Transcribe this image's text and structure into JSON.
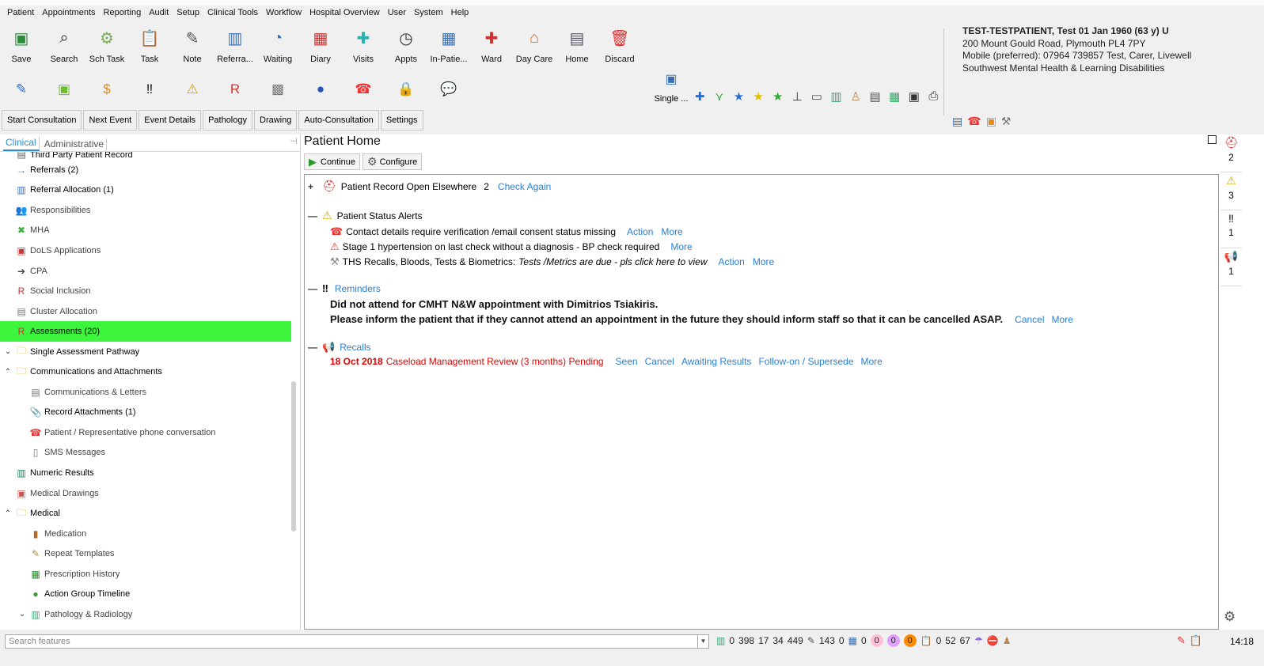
{
  "menu": [
    "Patient",
    "Appointments",
    "Reporting",
    "Audit",
    "Setup",
    "Clinical Tools",
    "Workflow",
    "Hospital Overview",
    "User",
    "System",
    "Help"
  ],
  "toolbar_main": [
    {
      "label": "Save",
      "icon": "save-icon",
      "glyph": "▣",
      "color": "#2e8b3d"
    },
    {
      "label": "Search",
      "icon": "search-icon",
      "glyph": "⌕",
      "color": "#333"
    },
    {
      "label": "Sch Task",
      "icon": "scheduled-task-icon",
      "glyph": "⚙",
      "color": "#7a5"
    },
    {
      "label": "Task",
      "icon": "task-icon",
      "glyph": "📋",
      "color": "#b8860b"
    },
    {
      "label": "Note",
      "icon": "note-icon",
      "glyph": "✎",
      "color": "#555"
    },
    {
      "label": "Referra...",
      "icon": "referral-icon",
      "glyph": "▥",
      "color": "#3a6fb5"
    },
    {
      "label": "Waiting",
      "icon": "waiting-icon",
      "glyph": "◔",
      "color": "#3a6fb5"
    },
    {
      "label": "Diary",
      "icon": "diary-icon",
      "glyph": "▦",
      "color": "#c33"
    },
    {
      "label": "Visits",
      "icon": "visits-icon",
      "glyph": "✚",
      "color": "#2ab0b0"
    },
    {
      "label": "Appts",
      "icon": "appointments-icon",
      "glyph": "◷",
      "color": "#333"
    },
    {
      "label": "In-Patie...",
      "icon": "in-patient-icon",
      "glyph": "▦",
      "color": "#3a6fb5"
    },
    {
      "label": "Ward",
      "icon": "ward-icon",
      "glyph": "✚",
      "color": "#c33"
    },
    {
      "label": "Day Care",
      "icon": "day-care-icon",
      "glyph": "⌂",
      "color": "#d2691e"
    },
    {
      "label": "Home",
      "icon": "home-icon",
      "glyph": "▤",
      "color": "#556"
    },
    {
      "label": "Discard",
      "icon": "discard-icon",
      "glyph": "🗑",
      "color": "#d33"
    }
  ],
  "toolbar_row2": [
    {
      "icon": "edit-user-icon",
      "glyph": "✎",
      "color": "#2a6fd0"
    },
    {
      "icon": "assessment-icon",
      "glyph": "▣",
      "color": "#6bbf2a"
    },
    {
      "icon": "document-icon",
      "glyph": "$",
      "color": "#e08a1a"
    },
    {
      "icon": "reminders-icon",
      "glyph": "‼",
      "color": "#111"
    },
    {
      "icon": "warning-person-icon",
      "glyph": "⚠",
      "color": "#d8a000"
    },
    {
      "icon": "form-r-icon",
      "glyph": "R",
      "color": "#c33"
    },
    {
      "icon": "grid-icon",
      "glyph": "▩",
      "color": "#777"
    },
    {
      "icon": "blue-circle-icon",
      "glyph": "●",
      "color": "#2a55b5"
    },
    {
      "icon": "phone-icon",
      "glyph": "☎",
      "color": "#e33"
    },
    {
      "icon": "lock-icon",
      "glyph": "🔒",
      "color": "#555"
    },
    {
      "icon": "chat-icon",
      "glyph": "💬",
      "color": "#8a6fd0"
    }
  ],
  "single_button": {
    "label": "Single ..."
  },
  "small_icons": [
    {
      "icon": "medical-bag-icon",
      "glyph": "✚",
      "color": "#2a6fd0"
    },
    {
      "icon": "filter-icon",
      "glyph": "⋎",
      "color": "#4a4"
    },
    {
      "icon": "blue-star-icon",
      "glyph": "★",
      "color": "#2a6fd0"
    },
    {
      "icon": "yellow-star-icon",
      "glyph": "★",
      "color": "#e0c000"
    },
    {
      "icon": "green-star-icon",
      "glyph": "★",
      "color": "#3a3"
    },
    {
      "icon": "split-icon",
      "glyph": "⊥",
      "color": "#333"
    },
    {
      "icon": "window-icon",
      "glyph": "▭",
      "color": "#555"
    },
    {
      "icon": "bar-chart-icon",
      "glyph": "▥",
      "color": "#3a7"
    },
    {
      "icon": "doctor-icon",
      "glyph": "♙",
      "color": "#b85"
    },
    {
      "icon": "notes-icon",
      "glyph": "▤",
      "color": "#555"
    },
    {
      "icon": "folder-icon",
      "glyph": "▦",
      "color": "#3a6"
    },
    {
      "icon": "print-preview-icon",
      "glyph": "▣",
      "color": "#333"
    },
    {
      "icon": "print-icon",
      "glyph": "⎙",
      "color": "#333"
    }
  ],
  "patient": {
    "name": "TEST-TESTPATIENT, Test 01 Jan 1960 (63 y) U",
    "address": "200 Mount Gould Road, Plymouth PL4 7PY",
    "mobile": "Mobile (preferred): 07964 739857   Test, Carer, Livewell",
    "team": "Southwest Mental Health & Learning Disabilities"
  },
  "consult_buttons": [
    "Start Consultation",
    "Next Event",
    "Event Details",
    "Pathology",
    "Drawing",
    "Auto-Consultation",
    "Settings"
  ],
  "left_tabs": [
    "Clinical",
    "Administrative"
  ],
  "tree": [
    {
      "label": "Third Party Patient Record",
      "icon": "record-icon",
      "glyph": "▤",
      "color": "#555",
      "indent": 0,
      "arrow": "",
      "partial": true
    },
    {
      "label": "Referrals (2)",
      "icon": "arrow-right-icon",
      "glyph": "→",
      "color": "#2a6fd0",
      "indent": 0,
      "arrow": ""
    },
    {
      "label": "Referral Allocation (1)",
      "icon": "referral-allocation-icon",
      "glyph": "▥",
      "color": "#3a6fb5",
      "indent": 0,
      "arrow": ""
    },
    {
      "label": "Responsibilities",
      "icon": "people-icon",
      "glyph": "👥",
      "color": "#e08a40",
      "indent": 0,
      "arrow": "",
      "grey": true
    },
    {
      "label": "MHA",
      "icon": "mha-icon",
      "glyph": "✖",
      "color": "#3ab03a",
      "indent": 0,
      "arrow": "",
      "grey": true
    },
    {
      "label": "DoLS Applications",
      "icon": "dols-icon",
      "glyph": "▣",
      "color": "#c33",
      "indent": 0,
      "arrow": "",
      "grey": true
    },
    {
      "label": "CPA",
      "icon": "cpa-arrow-icon",
      "glyph": "➔",
      "color": "#444",
      "indent": 0,
      "arrow": "",
      "grey": true
    },
    {
      "label": "Social Inclusion",
      "icon": "social-inclusion-icon",
      "glyph": "R",
      "color": "#c33",
      "indent": 0,
      "arrow": "",
      "grey": true
    },
    {
      "label": "Cluster Allocation",
      "icon": "cluster-icon",
      "glyph": "▤",
      "color": "#777",
      "indent": 0,
      "arrow": "",
      "grey": true
    },
    {
      "label": "Assessments (20)",
      "icon": "assessments-icon",
      "glyph": "R",
      "color": "#c33",
      "indent": 0,
      "arrow": "",
      "selected": true
    },
    {
      "label": "Single Assessment Pathway",
      "icon": "folder-icon",
      "glyph": "🗀",
      "color": "#d8b000",
      "indent": 0,
      "arrow": "⌄"
    },
    {
      "label": "Communications and Attachments",
      "icon": "folder-open-icon",
      "glyph": "🗀",
      "color": "#d8b000",
      "indent": 0,
      "arrow": "⌃"
    },
    {
      "label": "Communications & Letters",
      "icon": "letters-icon",
      "glyph": "▤",
      "color": "#777",
      "indent": 1,
      "arrow": "",
      "grey": true
    },
    {
      "label": "Record Attachments (1)",
      "icon": "paperclip-icon",
      "glyph": "📎",
      "color": "#555",
      "indent": 1,
      "arrow": ""
    },
    {
      "label": "Patient / Representative phone conversation",
      "icon": "phone-icon",
      "glyph": "☎",
      "color": "#e33",
      "indent": 1,
      "arrow": "",
      "grey": true
    },
    {
      "label": "SMS Messages",
      "icon": "sms-icon",
      "glyph": "▯",
      "color": "#777",
      "indent": 1,
      "arrow": "",
      "grey": true
    },
    {
      "label": "Numeric Results",
      "icon": "chart-icon",
      "glyph": "▥",
      "color": "#2a7f5a",
      "indent": 0,
      "arrow": ""
    },
    {
      "label": "Medical Drawings",
      "icon": "drawing-icon",
      "glyph": "▣",
      "color": "#c55",
      "indent": 0,
      "arrow": "",
      "grey": true
    },
    {
      "label": "Medical",
      "icon": "folder-open-icon",
      "glyph": "🗀",
      "color": "#d8b000",
      "indent": 0,
      "arrow": "⌃"
    },
    {
      "label": "Medication",
      "icon": "medication-icon",
      "glyph": "▮",
      "color": "#b06a2a",
      "indent": 1,
      "arrow": "",
      "grey": true
    },
    {
      "label": "Repeat Templates",
      "icon": "repeat-templates-icon",
      "glyph": "✎",
      "color": "#b08a40",
      "indent": 1,
      "arrow": "",
      "grey": true
    },
    {
      "label": "Prescription History",
      "icon": "prescription-icon",
      "glyph": "▦",
      "color": "#2a8a2a",
      "indent": 1,
      "arrow": "",
      "grey": true
    },
    {
      "label": "Action Group Timeline",
      "icon": "timeline-icon",
      "glyph": "●",
      "color": "#3a9a3a",
      "indent": 1,
      "arrow": ""
    },
    {
      "label": "Pathology & Radiology",
      "icon": "pathology-icon",
      "glyph": "▥",
      "color": "#3a7",
      "indent": 1,
      "arrow": "⌄",
      "grey": true
    }
  ],
  "main": {
    "title": "Patient Home",
    "continue": "Continue",
    "configure": "Configure",
    "record_open": {
      "label": "Patient Record Open Elsewhere",
      "count": "2",
      "link": "Check Again"
    },
    "alerts_title": "Patient Status Alerts",
    "alerts": [
      {
        "icon": "phone-icon",
        "glyph": "☎",
        "color": "#e33",
        "text": "Contact details require verification /email consent status missing",
        "italic": "",
        "links": [
          "Action",
          "More"
        ]
      },
      {
        "icon": "warning-icon",
        "glyph": "⚠",
        "color": "#d33",
        "text": "Stage 1 hypertension on last check without a diagnosis - BP check required",
        "italic": "",
        "links": [
          "More"
        ]
      },
      {
        "icon": "tools-icon",
        "glyph": "⚒",
        "color": "#888",
        "text": "THS Recalls, Bloods, Tests & Biometrics:",
        "italic": "Tests /Metrics are due - pls click here to view",
        "links": [
          "Action",
          "More"
        ]
      }
    ],
    "reminders_title": "Reminders",
    "reminder_line1": "Did not attend for CMHT N&W appointment with Dimitrios Tsiakiris.",
    "reminder_line2": "Please inform the patient that if they cannot attend an appointment in the future they should inform staff so that it can be cancelled ASAP.",
    "reminder_links": [
      "Cancel",
      "More"
    ],
    "recalls_title": "Recalls",
    "recall_date": "18 Oct 2018",
    "recall_text": "Caseload Management Review (3 months) Pending",
    "recall_links": [
      "Seen",
      "Cancel",
      "Awaiting Results",
      "Follow-on / Supersede",
      "More"
    ]
  },
  "sidebar": [
    {
      "icon": "record-alert-icon",
      "glyph": "⛑",
      "color": "#d33",
      "count": "2"
    },
    {
      "icon": "warning-icon",
      "glyph": "⚠",
      "color": "#d8b000",
      "count": "3"
    },
    {
      "icon": "reminders-icon",
      "glyph": "‼",
      "color": "#111",
      "count": "1"
    },
    {
      "icon": "recalls-icon",
      "glyph": "📢",
      "color": "#c8a000",
      "count": "1"
    }
  ],
  "status": {
    "search_placeholder": "Search features",
    "counts": [
      "0",
      "398",
      "17",
      "34",
      "449",
      "143",
      "0",
      "0",
      "0",
      "0",
      "0",
      "0",
      "52",
      "67"
    ],
    "time": "14:18"
  }
}
